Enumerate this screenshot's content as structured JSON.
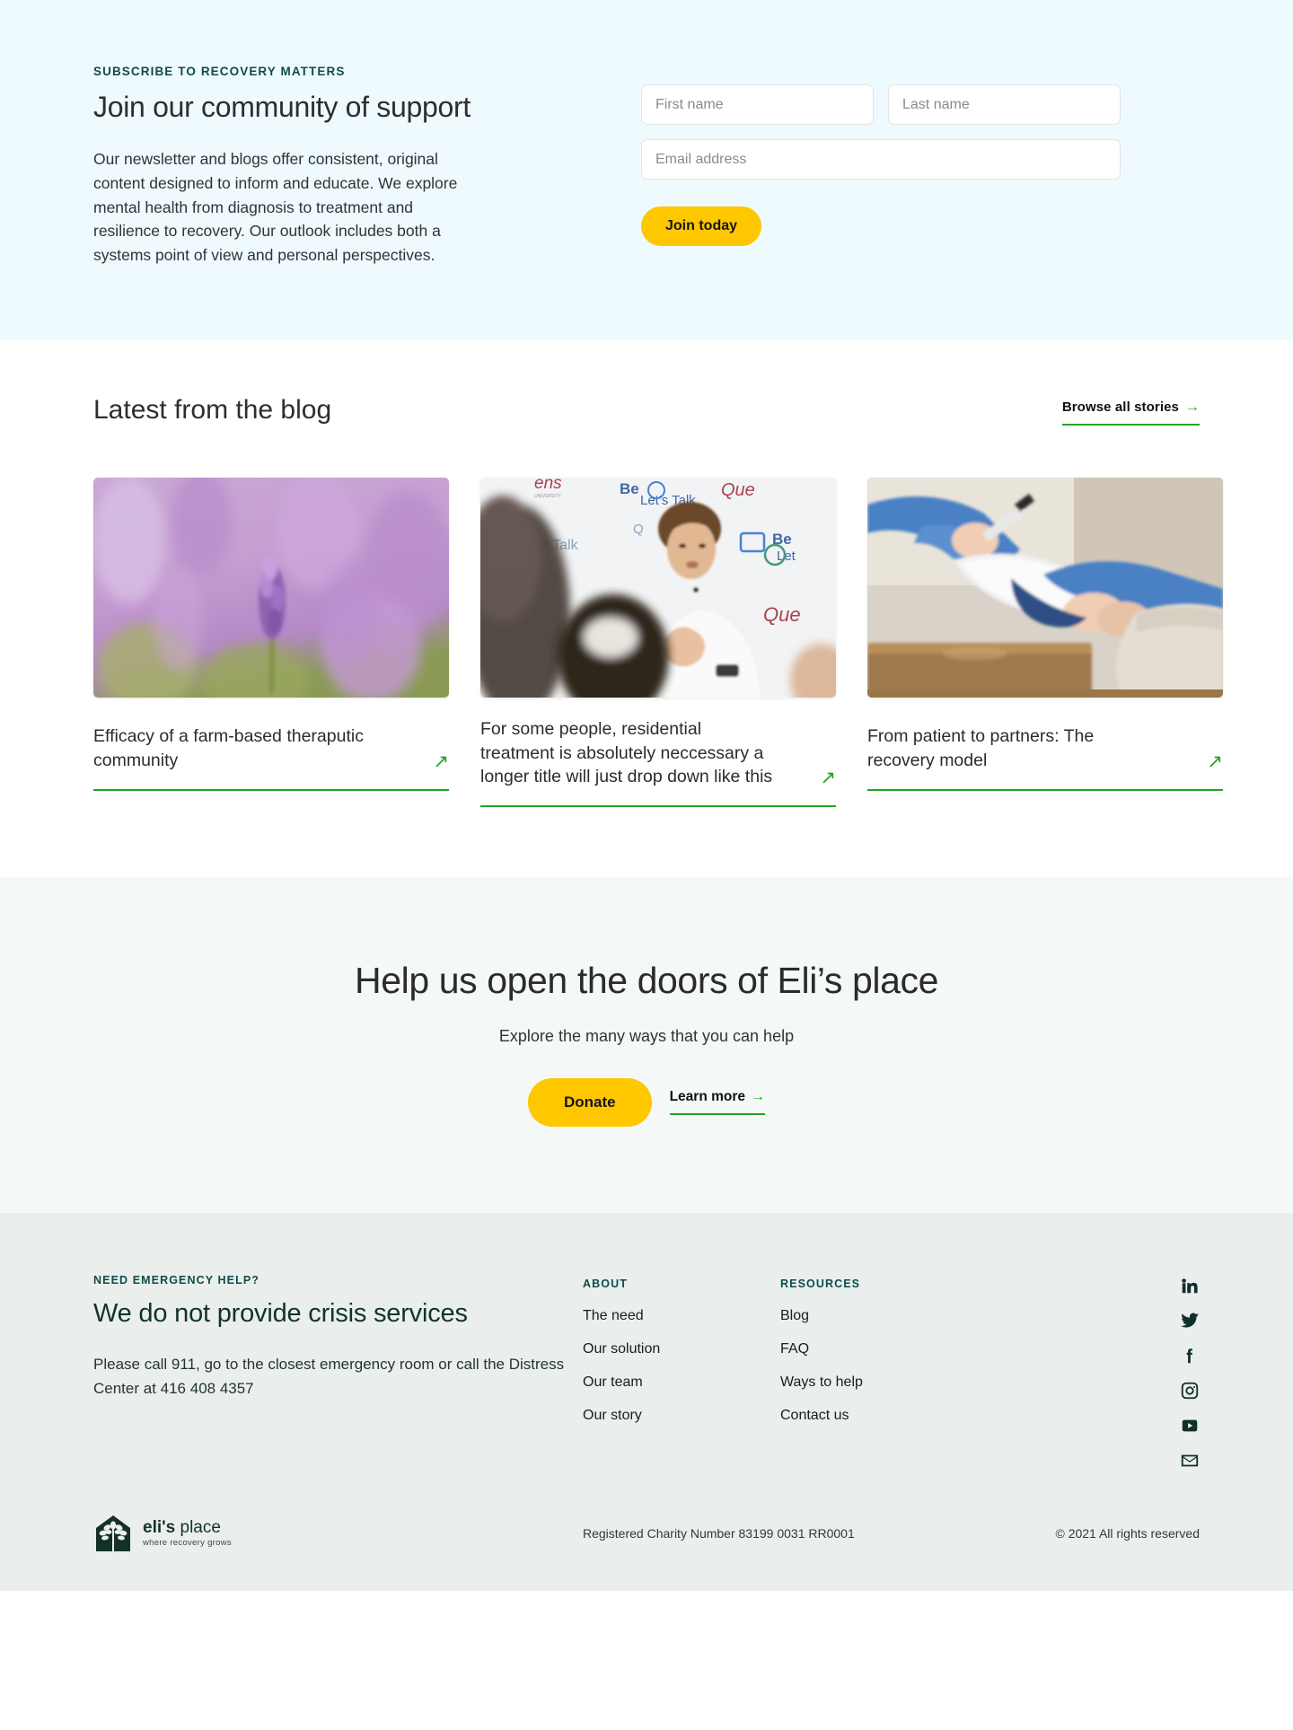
{
  "newsletter": {
    "eyebrow": "SUBSCRIBE TO RECOVERY MATTERS",
    "title": "Join our community of support",
    "body": "Our newsletter and blogs offer consistent, original content designed to inform and educate. We explore mental health from diagnosis to treatment and resilience to recovery. Our outlook includes both a systems point of view and personal perspectives.",
    "form": {
      "first_name_placeholder": "First name",
      "first_name_value": "",
      "last_name_placeholder": "Last name",
      "last_name_value": "",
      "email_placeholder": "Email address",
      "email_value": "",
      "submit_label": "Join today"
    },
    "bg_color": "#eefafd",
    "accent_color": "#0d4c48"
  },
  "blog": {
    "title": "Latest from the blog",
    "browse_label": "Browse all stories",
    "browse_arrow": "→",
    "card_arrow": "↗",
    "accent_color": "#22a522",
    "cards": [
      {
        "title": "Efficacy of a farm-based theraputic community",
        "image": "lavender-field-photo"
      },
      {
        "title": "For some people, residential treatment is absolutely neccessary a longer title will just drop down like this",
        "image": "young-man-speaking-bell-lets-talk-photo"
      },
      {
        "title": "From patient to partners: The recovery model",
        "image": "therapy-session-clipboard-photo"
      }
    ]
  },
  "cta": {
    "title": "Help us open the doors of Eli’s place",
    "subtitle": "Explore the many ways that you can help",
    "donate_label": "Donate",
    "learn_label": "Learn more",
    "learn_arrow": "→",
    "bg_color": "#f5f8f8",
    "button_color": "#ffc700"
  },
  "footer": {
    "eyebrow": "NEED EMERGENCY HELP?",
    "title": "We do not provide crisis services",
    "body": "Please call 911, go to the closest emergency room or call the Distress Center at 416 408 4357",
    "columns": [
      {
        "heading": "ABOUT",
        "links": [
          "The need",
          "Our solution",
          "Our team",
          "Our story"
        ]
      },
      {
        "heading": "RESOURCES",
        "links": [
          "Blog",
          "FAQ",
          "Ways to help",
          "Contact us"
        ]
      }
    ],
    "social": [
      {
        "name": "linkedin-icon",
        "label": "LinkedIn"
      },
      {
        "name": "twitter-icon",
        "label": "Twitter"
      },
      {
        "name": "facebook-icon",
        "label": "Facebook"
      },
      {
        "name": "instagram-icon",
        "label": "Instagram"
      },
      {
        "name": "youtube-icon",
        "label": "YouTube"
      },
      {
        "name": "email-icon",
        "label": "Email"
      }
    ],
    "logo": {
      "word1": "eli's",
      "word2": "place",
      "tagline": "where recovery grows"
    },
    "charity": "Registered Charity Number 83199 0031 RR0001",
    "copyright": "© 2021 All rights reserved",
    "bg_color": "#eaefee"
  }
}
